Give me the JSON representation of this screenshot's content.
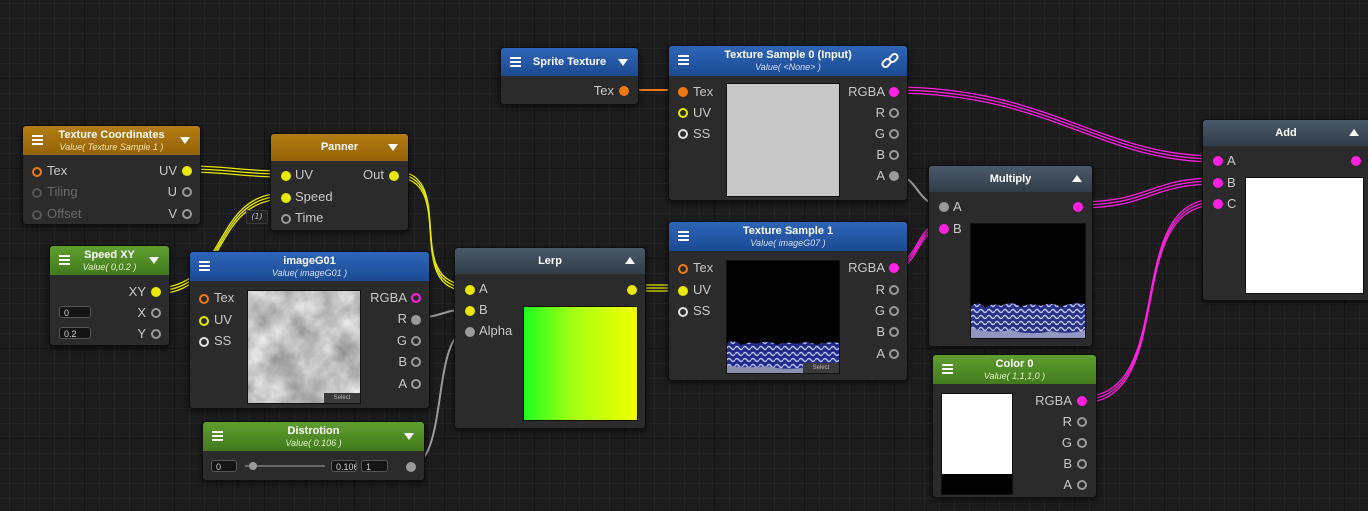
{
  "colors": {
    "vector": "#e8e800",
    "texture": "#f07a12",
    "color": "#ff20e0",
    "float": "#9a9a9a"
  },
  "badge_label": "(1)",
  "nodes": {
    "sprite_texture": {
      "title": "Sprite Texture",
      "out": "Tex"
    },
    "texture_sample_0": {
      "title": "Texture Sample 0 (Input)",
      "subtitle": "Value( <None> )",
      "inputs": [
        "Tex",
        "UV",
        "SS"
      ],
      "outputs": [
        "RGBA",
        "R",
        "G",
        "B",
        "A"
      ]
    },
    "texture_coordinates": {
      "title": "Texture Coordinates",
      "subtitle": "Value( Texture Sample 1 )",
      "inputs": [
        "Tex",
        "Tiling",
        "Offset"
      ],
      "outputs": [
        "UV",
        "U",
        "V"
      ]
    },
    "panner": {
      "title": "Panner",
      "inputs": [
        "UV",
        "Speed",
        "Time"
      ],
      "outputs": [
        "Out"
      ]
    },
    "speed_xy": {
      "title": "Speed XY",
      "subtitle": "Value( 0,0.2 )",
      "outputs": [
        "XY",
        "X",
        "Y"
      ],
      "field_x": "0",
      "field_y": "0.2"
    },
    "image_g01": {
      "title": "imageG01",
      "subtitle": "Value( imageG01 )",
      "inputs": [
        "Tex",
        "UV",
        "SS"
      ],
      "outputs": [
        "RGBA",
        "R",
        "G",
        "B",
        "A"
      ],
      "select": "Select"
    },
    "distortion": {
      "title": "Distrotion",
      "subtitle": "Value( 0.106 )",
      "min": "0",
      "value": "0.106",
      "max": "1",
      "slider_fraction": 0.106
    },
    "lerp": {
      "title": "Lerp",
      "inputs": [
        "A",
        "B",
        "Alpha"
      ]
    },
    "texture_sample_1": {
      "title": "Texture Sample 1",
      "subtitle": "Value( imageG07 )",
      "inputs": [
        "Tex",
        "UV",
        "SS"
      ],
      "outputs": [
        "RGBA",
        "R",
        "G",
        "B",
        "A"
      ],
      "select": "Select"
    },
    "multiply": {
      "title": "Multiply",
      "inputs": [
        "A",
        "B"
      ]
    },
    "add": {
      "title": "Add",
      "inputs": [
        "A",
        "B",
        "C"
      ]
    },
    "color_0": {
      "title": "Color 0",
      "subtitle": "Value( 1,1,1,0 )",
      "outputs": [
        "RGBA",
        "R",
        "G",
        "B",
        "A"
      ]
    }
  }
}
